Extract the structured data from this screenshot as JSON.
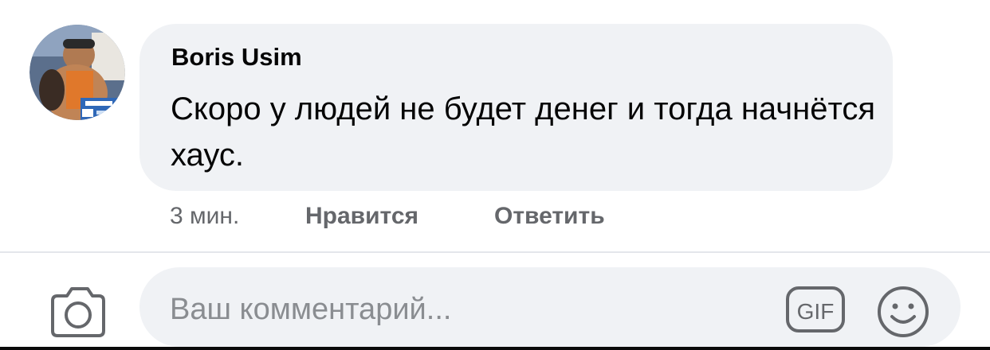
{
  "comment": {
    "author": "Boris Usim",
    "text": "Скоро у людей не будет денег и тогда начнётся хаус.",
    "time": "3 мин.",
    "like_label": "Нравится",
    "reply_label": "Ответить"
  },
  "composer": {
    "placeholder": "Ваш комментарий..."
  },
  "icons": {
    "camera": "camera-icon",
    "gif": "gif-icon",
    "emoji": "smiley-icon"
  },
  "colors": {
    "bubble": "#f0f2f5",
    "primary_text": "#050505",
    "secondary_text": "#65676b",
    "placeholder": "#8a8d91"
  }
}
